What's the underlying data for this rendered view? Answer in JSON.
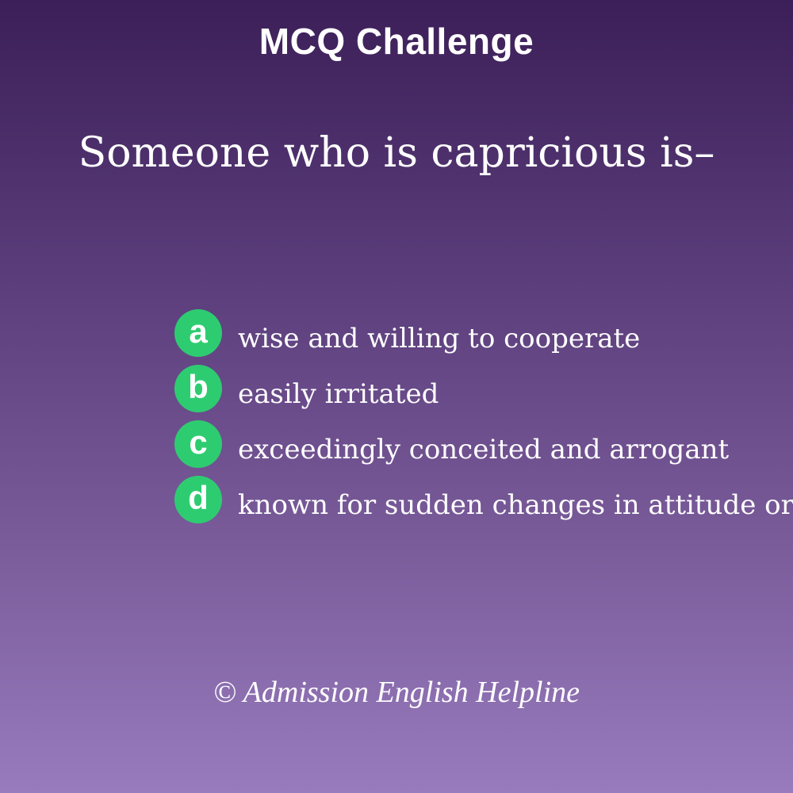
{
  "header": {
    "title": "MCQ Challenge"
  },
  "question": {
    "text": "Someone who is capricious is–"
  },
  "options": [
    {
      "letter": "a",
      "text": "wise and willing to cooperate"
    },
    {
      "letter": "b",
      "text": "easily irritated"
    },
    {
      "letter": "c",
      "text": "exceedingly conceited and arrogant"
    },
    {
      "letter": "d",
      "text": "known for sudden changes in attitude or"
    }
  ],
  "footer": {
    "copyright": "© Admission English Helpline"
  },
  "colors": {
    "background_top": "#3c1f58",
    "background_bottom": "#977bbd",
    "option_badge": "#2ecc71",
    "text": "#ffffff"
  }
}
